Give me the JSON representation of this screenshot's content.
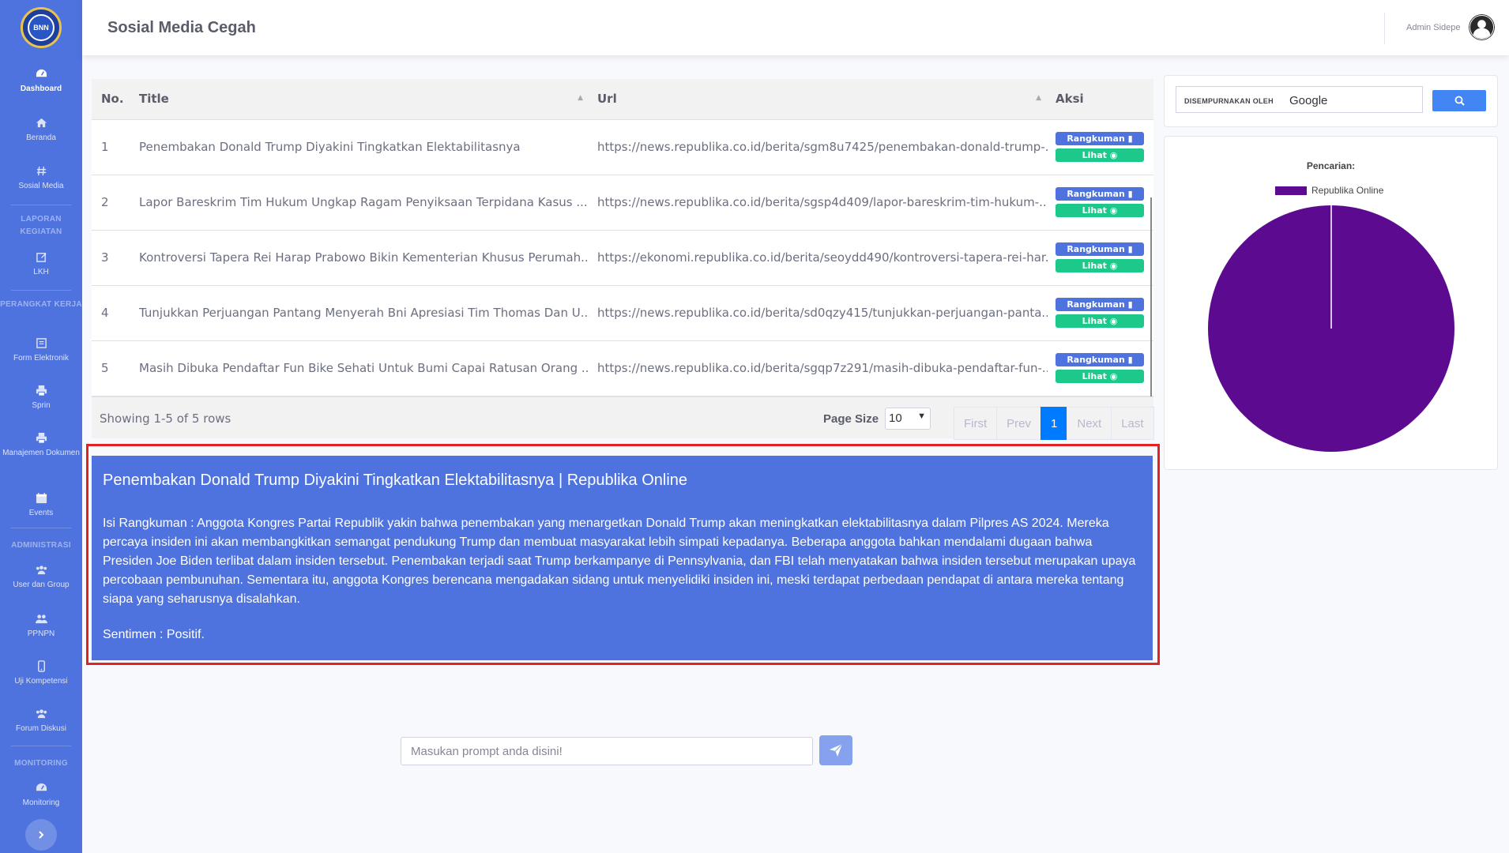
{
  "app": {
    "page_title": "Sosial Media Cegah",
    "user_name": "Admin Sidepe",
    "logo_text": "BNN"
  },
  "sidebar": {
    "items": [
      {
        "label": "Dashboard",
        "icon": "dashboard-icon"
      },
      {
        "label": "Beranda",
        "icon": "home-icon"
      },
      {
        "label": "Sosial Media",
        "icon": "hashtag-icon"
      },
      {
        "label": "LKH",
        "icon": "edit-icon"
      },
      {
        "label": "Form Elektronik",
        "icon": "form-icon"
      },
      {
        "label": "Sprin",
        "icon": "print-icon"
      },
      {
        "label": "Manajemen Dokumen",
        "icon": "print-icon"
      },
      {
        "label": "Events",
        "icon": "calendar-icon"
      },
      {
        "label": "User dan Group",
        "icon": "users-icon"
      },
      {
        "label": "PPNPN",
        "icon": "user-friends-icon"
      },
      {
        "label": "Uji Kompetensi",
        "icon": "mobile-icon"
      },
      {
        "label": "Forum Diskusi",
        "icon": "users-icon"
      },
      {
        "label": "Monitoring",
        "icon": "gauge-icon"
      }
    ],
    "headings": {
      "laporan": "LAPORAN KEGIATAN",
      "perangkat": "PERANGKAT KERJA",
      "administrasi": "ADMINISTRASI",
      "monitoring": "MONITORING"
    }
  },
  "table": {
    "headers": {
      "no": "No.",
      "title": "Title",
      "url": "Url",
      "aksi": "Aksi"
    },
    "btn_rangkuman": "Rangkuman",
    "btn_lihat": "Lihat",
    "rows": [
      {
        "no": "1",
        "title": "Penembakan Donald Trump Diyakini Tingkatkan Elektabilitasnya",
        "url": "https://news.republika.co.id/berita/sgm8u7425/penembakan-donald-trump-..."
      },
      {
        "no": "2",
        "title": "Lapor Bareskrim Tim Hukum Ungkap Ragam Penyiksaan Terpidana Kasus ...",
        "url": "https://news.republika.co.id/berita/sgsp4d409/lapor-bareskrim-tim-hukum-..."
      },
      {
        "no": "3",
        "title": "Kontroversi Tapera Rei Harap Prabowo Bikin Kementerian Khusus Perumah...",
        "url": "https://ekonomi.republika.co.id/berita/seoydd490/kontroversi-tapera-rei-har..."
      },
      {
        "no": "4",
        "title": "Tunjukkan Perjuangan Pantang Menyerah Bni Apresiasi Tim Thomas Dan U...",
        "url": "https://news.republika.co.id/berita/sd0qzy415/tunjukkan-perjuangan-panta..."
      },
      {
        "no": "5",
        "title": "Masih Dibuka Pendaftar Fun Bike Sehati Untuk Bumi Capai Ratusan Orang ...",
        "url": "https://news.republika.co.id/berita/sgqp7z291/masih-dibuka-pendaftar-fun-..."
      }
    ],
    "showing": "Showing 1-5 of 5 rows",
    "page_size_label": "Page Size",
    "page_size_value": "10",
    "pager": {
      "first": "First",
      "prev": "Prev",
      "current": "1",
      "next": "Next",
      "last": "Last"
    }
  },
  "summary": {
    "title": "Penembakan Donald Trump Diyakini Tingkatkan Elektabilitasnya | Republika Online",
    "body": "Isi Rangkuman : Anggota Kongres Partai Republik yakin bahwa penembakan yang menargetkan Donald Trump akan meningkatkan elektabilitasnya dalam Pilpres AS 2024. Mereka percaya insiden ini akan membangkitkan semangat pendukung Trump dan membuat masyarakat lebih simpati kepadanya. Beberapa anggota bahkan mendalami dugaan bahwa Presiden Joe Biden terlibat dalam insiden tersebut. Penembakan terjadi saat Trump berkampanye di Pennsylvania, dan FBI telah menyatakan bahwa insiden tersebut merupakan upaya percobaan pembunuhan. Sementara itu, anggota Kongres berencana mengadakan sidang untuk menyelidiki insiden ini, meski terdapat perbedaan pendapat di antara mereka tentang siapa yang seharusnya disalahkan.",
    "sentiment": "Sentimen : Positif."
  },
  "search": {
    "enhanced_by": "DISEMPURNAKAN OLEH",
    "brand": "Google"
  },
  "chart_data": {
    "type": "pie",
    "title": "Pencarian:",
    "categories": [
      "Republika Online"
    ],
    "values": [
      5
    ],
    "colors": [
      "#5c0a8f"
    ],
    "legend_position": "top"
  },
  "prompt": {
    "placeholder": "Masukan prompt anda disini!"
  },
  "colors": {
    "sidebar": "#4e73df",
    "summary_bg": "#4e73df",
    "highlight_border": "#e02424",
    "lihat_button": "#1cc88a",
    "pager_active": "#007bff"
  }
}
